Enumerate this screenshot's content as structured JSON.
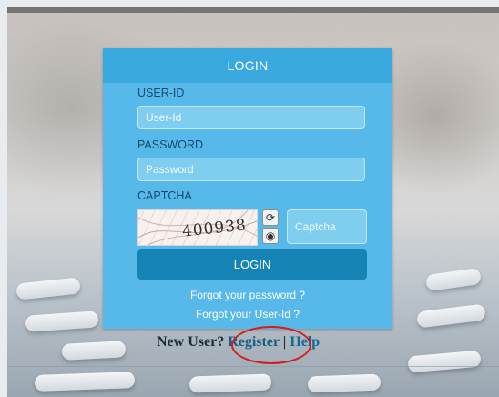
{
  "login_panel": {
    "title": "LOGIN",
    "userid_label": "USER-ID",
    "userid_placeholder": "User-Id",
    "password_label": "PASSWORD",
    "password_placeholder": "Password",
    "captcha_label": "CAPTCHA",
    "captcha_value": "400938",
    "captcha_placeholder": "Captcha",
    "refresh_icon": "refresh-icon",
    "audio_icon": "audio-captcha-icon",
    "login_button": "LOGIN",
    "forgot_password": "Forgot your password ?",
    "forgot_userid": "Forgot your User-Id ?"
  },
  "footer": {
    "new_user": "New User?",
    "register": "Register",
    "separator": "|",
    "help": "Help"
  },
  "colors": {
    "panel": "#56b9ea",
    "header": "#3aa9e0",
    "button": "#1683b5",
    "highlight_circle": "#d21e1e"
  }
}
